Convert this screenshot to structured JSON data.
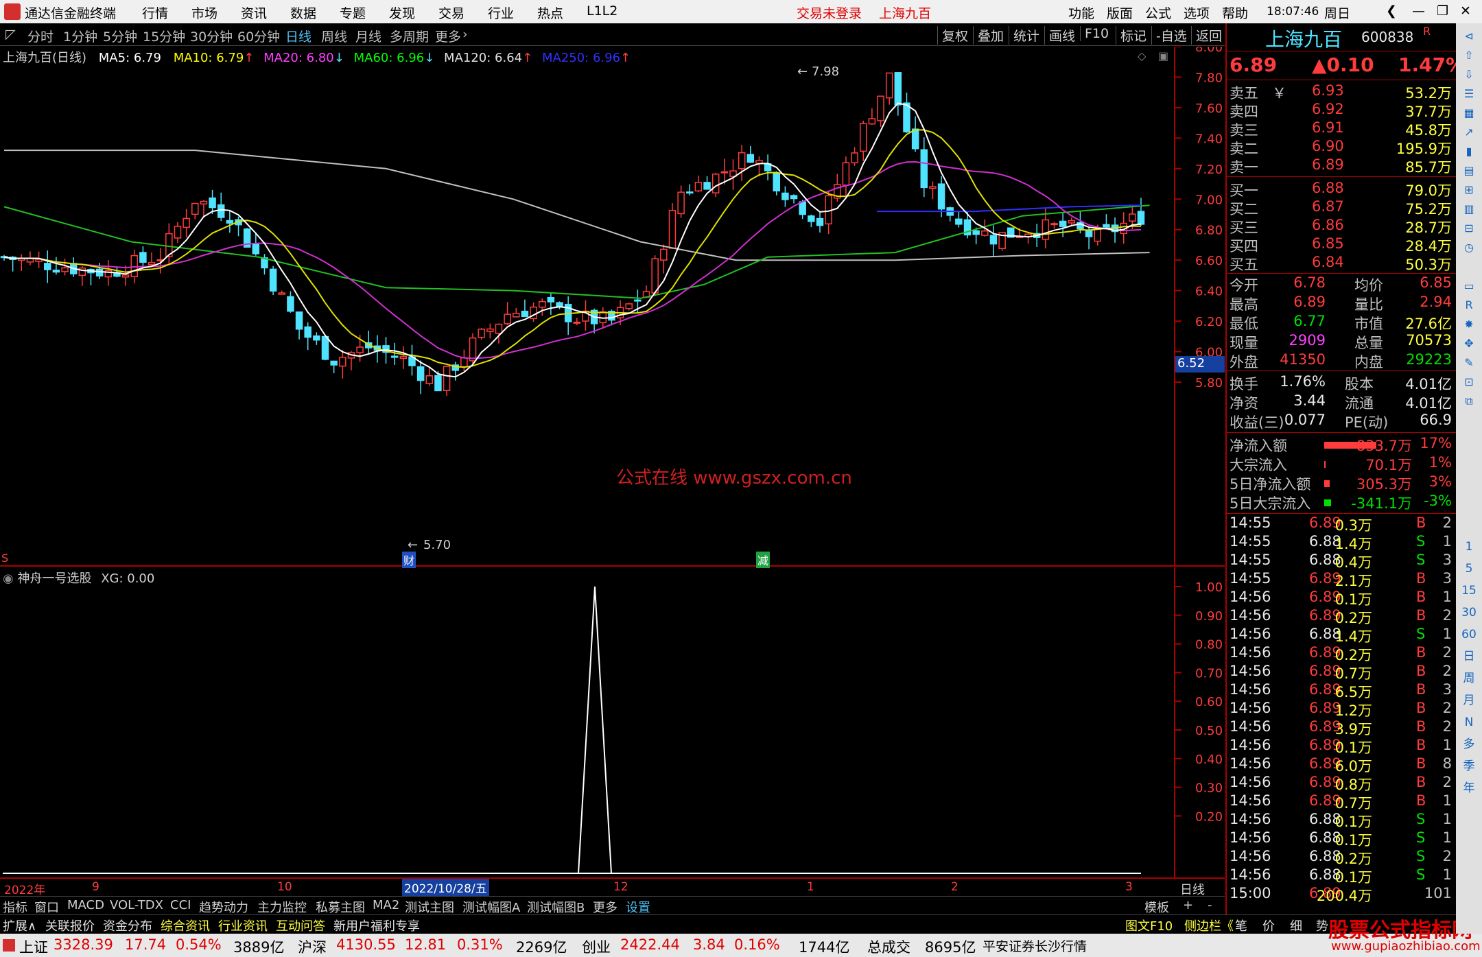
{
  "app": {
    "title": "通达信金融终端",
    "menu": [
      "行情",
      "市场",
      "资讯",
      "数据",
      "专题",
      "发现",
      "交易",
      "行业",
      "热点",
      "L1L2"
    ],
    "login": "交易未登录",
    "stock_title": "上海九百",
    "right_menu": [
      "功能",
      "版面",
      "公式",
      "选项",
      "帮助"
    ],
    "time": "18:07:46",
    "weekday": "周日"
  },
  "periods": [
    "分时",
    "1分钟",
    "5分钟",
    "15分钟",
    "30分钟",
    "60分钟",
    "日线",
    "周线",
    "月线",
    "多周期",
    "更多"
  ],
  "tools": [
    "复权",
    "叠加",
    "统计",
    "画线",
    "F10",
    "标记",
    "-自选",
    "返回"
  ],
  "ma_header": {
    "name": "上海九百(日线)",
    "ma5": "MA5: 6.79",
    "ma10": "MA10: 6.79",
    "ma20": "MA20: 6.80",
    "ma60": "MA60: 6.96",
    "ma120": "MA120: 6.64",
    "ma250": "MA250: 6.96"
  },
  "price_axis": [
    "8.00",
    "7.80",
    "7.60",
    "7.40",
    "7.20",
    "7.00",
    "6.80",
    "6.60",
    "6.40",
    "6.20",
    "6.00",
    "5.80"
  ],
  "price_tag": "6.52",
  "high_label": "7.98",
  "low_label": "5.70",
  "marker_cai": "财",
  "marker_jian": "减",
  "watermark": "公式在线 www.gszx.com.cn",
  "indicator": {
    "name": "神舟一号选股",
    "value": "XG: 0.00",
    "axis": [
      "1.00",
      "0.90",
      "0.80",
      "0.70",
      "0.60",
      "0.50",
      "0.40",
      "0.30",
      "0.20"
    ]
  },
  "date_axis": {
    "year": "2022年",
    "m9": "9",
    "m10": "10",
    "cursor": "2022/10/28/五",
    "m12": "12",
    "m1": "1",
    "m2": "2",
    "m3": "3",
    "period": "日线"
  },
  "tabs": [
    "指标",
    "窗口",
    "MACD",
    "VOL-TDX",
    "CCI",
    "趋势动力",
    "主力监控",
    "私募主图",
    "MA2",
    "测试主图",
    "测试幅图A",
    "测试幅图B",
    "更多",
    "设置"
  ],
  "tabs_right": [
    "模板",
    "+",
    "-"
  ],
  "bottom2": {
    "left": [
      "扩展∧",
      "关联报价",
      "资金分布",
      "综合资讯",
      "行业资讯",
      "互动问答",
      "新用户福利专享"
    ],
    "right": [
      "图文F10",
      "侧边栏《",
      "笔",
      "价",
      "细",
      "势"
    ]
  },
  "status": {
    "sh_label": "上证",
    "sh_val": "3328.39",
    "sh_chg": "17.74",
    "sh_pct": "0.54%",
    "sh_amt": "3889亿",
    "sz_label": "沪深",
    "sz_val": "4130.55",
    "sz_chg": "12.81",
    "sz_pct": "0.31%",
    "sz_amt": "2269亿",
    "cy_label": "创业",
    "cy_val": "2422.44",
    "cy_chg": "3.84",
    "cy_pct": "0.16%",
    "cy_amt": "1744亿",
    "total_label": "总成交",
    "total_amt": "8695亿",
    "broker": "平安证券长沙行情",
    "logo": "股票公式指标网",
    "logo_url": "www.gupiaozhibiao.com"
  },
  "quote": {
    "name": "上海九百",
    "code": "600838",
    "flag": "R",
    "price": "6.89",
    "change": "▲0.10",
    "pct": "1.47%"
  },
  "sells": [
    [
      "卖五",
      "6.93",
      "53.2万"
    ],
    [
      "卖四",
      "6.92",
      "37.7万"
    ],
    [
      "卖三",
      "6.91",
      "45.8万"
    ],
    [
      "卖二",
      "6.90",
      "195.9万"
    ],
    [
      "卖一",
      "6.89",
      "85.7万"
    ]
  ],
  "buys": [
    [
      "买一",
      "6.88",
      "79.0万"
    ],
    [
      "买二",
      "6.87",
      "75.2万"
    ],
    [
      "买三",
      "6.86",
      "28.7万"
    ],
    [
      "买四",
      "6.85",
      "28.4万"
    ],
    [
      "买五",
      "6.84",
      "50.3万"
    ]
  ],
  "yen": "￥",
  "stats1": [
    [
      "今开",
      "6.78",
      "均价",
      "6.85"
    ],
    [
      "最高",
      "6.89",
      "量比",
      "2.94"
    ],
    [
      "最低",
      "6.77",
      "市值",
      "27.6亿"
    ],
    [
      "现量",
      "2909",
      "总量",
      "70573"
    ],
    [
      "外盘",
      "41350",
      "内盘",
      "29223"
    ]
  ],
  "stats2": [
    [
      "换手",
      "1.76%",
      "股本",
      "4.01亿"
    ],
    [
      "净资",
      "3.44",
      "流通",
      "4.01亿"
    ],
    [
      "收益(三)",
      "0.077",
      "PE(动)",
      "66.9"
    ]
  ],
  "flows": [
    [
      "净流入额",
      "833.7万",
      "17%"
    ],
    [
      "大宗流入",
      "70.1万",
      "1%"
    ],
    [
      "5日净流入额",
      "305.3万",
      "3%"
    ],
    [
      "5日大宗流入",
      "-341.1万",
      "-3%"
    ]
  ],
  "ticks": [
    [
      "14:55",
      "6.89",
      "0.3万",
      "B",
      "2"
    ],
    [
      "14:55",
      "6.88",
      "1.4万",
      "S",
      "1"
    ],
    [
      "14:55",
      "6.88",
      "0.4万",
      "S",
      "3"
    ],
    [
      "14:55",
      "6.89",
      "2.1万",
      "B",
      "3"
    ],
    [
      "14:56",
      "6.89",
      "0.1万",
      "B",
      "1"
    ],
    [
      "14:56",
      "6.89",
      "0.2万",
      "B",
      "2"
    ],
    [
      "14:56",
      "6.88",
      "1.4万",
      "S",
      "1"
    ],
    [
      "14:56",
      "6.89",
      "0.2万",
      "B",
      "2"
    ],
    [
      "14:56",
      "6.89",
      "0.7万",
      "B",
      "2"
    ],
    [
      "14:56",
      "6.89",
      "6.5万",
      "B",
      "3"
    ],
    [
      "14:56",
      "6.89",
      "1.2万",
      "B",
      "2"
    ],
    [
      "14:56",
      "6.89",
      "3.9万",
      "B",
      "2"
    ],
    [
      "14:56",
      "6.89",
      "0.1万",
      "B",
      "1"
    ],
    [
      "14:56",
      "6.89",
      "6.0万",
      "B",
      "8"
    ],
    [
      "14:56",
      "6.89",
      "0.8万",
      "B",
      "2"
    ],
    [
      "14:56",
      "6.89",
      "0.7万",
      "B",
      "1"
    ],
    [
      "14:56",
      "6.88",
      "0.1万",
      "S",
      "1"
    ],
    [
      "14:56",
      "6.88",
      "0.1万",
      "S",
      "1"
    ],
    [
      "14:56",
      "6.88",
      "0.2万",
      "S",
      "2"
    ],
    [
      "14:56",
      "6.88",
      "0.1万",
      "S",
      "1"
    ],
    [
      "15:00",
      "6.89",
      "200.4万",
      "",
      "101"
    ]
  ],
  "side_labels": [
    "1",
    "5",
    "15",
    "30",
    "60",
    "日",
    "周",
    "月",
    "N",
    "多",
    "季",
    "年"
  ],
  "colors": {
    "up": "#ff3c3c",
    "down": "#4fe3ff",
    "ma5": "#ffffff",
    "ma10": "#ffff00",
    "ma20": "#ff40ff",
    "ma60": "#00ff00",
    "ma120": "#c0c0c0",
    "ma250": "#4040ff"
  }
}
